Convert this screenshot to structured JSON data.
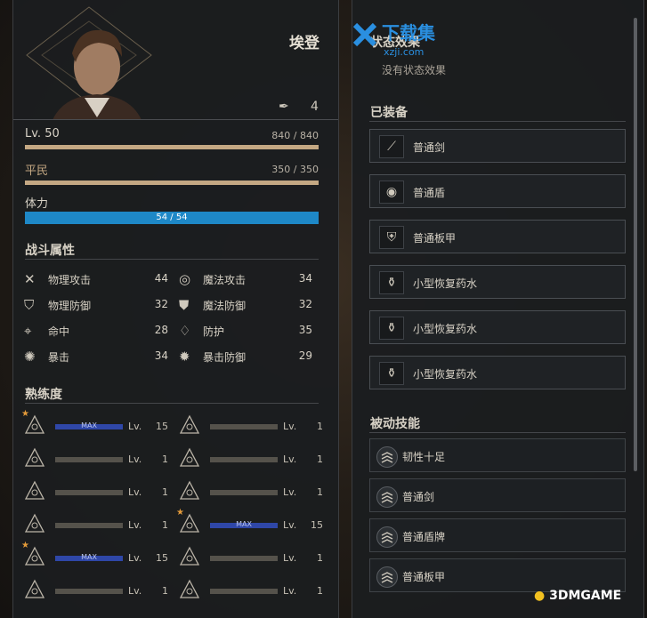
{
  "character": {
    "name": "埃登",
    "item_count": "4"
  },
  "bars": {
    "level": {
      "label": "Lv. 50",
      "value": "840 / 840",
      "ratio": 1.0
    },
    "rank": {
      "label": "平民",
      "value": "350 / 350",
      "ratio": 1.0
    },
    "stamina": {
      "label": "体力",
      "value": "54 / 54",
      "ratio": 1.0
    }
  },
  "combat": {
    "title": "战斗属性",
    "stats": [
      {
        "name": "物理攻击",
        "value": "44",
        "icon": "crossed-swords-icon"
      },
      {
        "name": "魔法攻击",
        "value": "34",
        "icon": "vortex-icon"
      },
      {
        "name": "物理防御",
        "value": "32",
        "icon": "shield-icon"
      },
      {
        "name": "魔法防御",
        "value": "32",
        "icon": "magic-shield-icon"
      },
      {
        "name": "命中",
        "value": "28",
        "icon": "target-icon"
      },
      {
        "name": "防护",
        "value": "35",
        "icon": "guard-icon"
      },
      {
        "name": "暴击",
        "value": "34",
        "icon": "burst-icon"
      },
      {
        "name": "暴击防御",
        "value": "29",
        "icon": "burst-shield-icon"
      }
    ]
  },
  "proficiency": {
    "title": "熟练度",
    "max_label": "MAX",
    "lv_prefix": "Lv.",
    "items": [
      {
        "level": "15",
        "max": true,
        "star": true,
        "icon": "sword-skill-icon"
      },
      {
        "level": "1",
        "max": false,
        "star": false,
        "icon": "axe-skill-icon"
      },
      {
        "level": "1",
        "max": false,
        "star": false,
        "icon": "spear-skill-icon"
      },
      {
        "level": "1",
        "max": false,
        "star": false,
        "icon": "dagger-skill-icon"
      },
      {
        "level": "1",
        "max": false,
        "star": false,
        "icon": "bow-skill-icon"
      },
      {
        "level": "1",
        "max": false,
        "star": false,
        "icon": "eye-skill-icon"
      },
      {
        "level": "1",
        "max": false,
        "star": false,
        "icon": "mace-skill-icon"
      },
      {
        "level": "15",
        "max": true,
        "star": true,
        "icon": "armor-skill-icon"
      },
      {
        "level": "15",
        "max": true,
        "star": true,
        "icon": "shield-skill-icon"
      },
      {
        "level": "1",
        "max": false,
        "star": false,
        "icon": "staff-skill-icon"
      },
      {
        "level": "1",
        "max": false,
        "star": false,
        "icon": "tome-skill-icon"
      },
      {
        "level": "1",
        "max": false,
        "star": false,
        "icon": "orb-skill-icon"
      }
    ]
  },
  "status": {
    "title": "状态效果",
    "empty": "没有状态效果"
  },
  "equipped": {
    "title": "已装备",
    "items": [
      {
        "name": "普通剑",
        "icon": "sword-icon"
      },
      {
        "name": "普通盾",
        "icon": "round-shield-icon"
      },
      {
        "name": "普通板甲",
        "icon": "plate-armor-icon"
      },
      {
        "name": "小型恢复药水",
        "icon": "potion-icon"
      },
      {
        "name": "小型恢复药水",
        "icon": "potion-icon"
      },
      {
        "name": "小型恢复药水",
        "icon": "potion-icon"
      }
    ]
  },
  "passive": {
    "title": "被动技能",
    "items": [
      {
        "name": "韧性十足"
      },
      {
        "name": "普通剑"
      },
      {
        "name": "普通盾牌"
      },
      {
        "name": "普通板甲"
      }
    ]
  },
  "watermark": {
    "top": "下载集",
    "top_sub": "xzji.com",
    "bottom": "3DMGAME"
  },
  "colors": {
    "accent": "#c4a883",
    "stamina": "#1e88c7",
    "max_bar": "#2f47a8",
    "star": "#e39a3a"
  }
}
